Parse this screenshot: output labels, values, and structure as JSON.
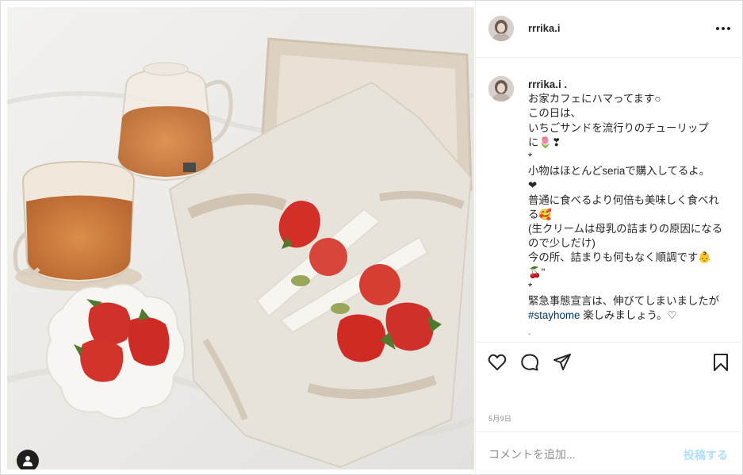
{
  "post": {
    "username": "rrrika.i",
    "caption_username": "rrrika.i .",
    "caption_lines": [
      "お家カフェにハマってます○",
      "この日は、",
      "いちごサンドを流行りのチューリップ",
      "に🌷❣",
      "*",
      "小物はほとんどseriaで購入してるよ。",
      "❤",
      "普通に食べるより何倍も美味しく食べれる🥰",
      "(生クリームは母乳の詰まりの原因になるので少しだけ)",
      "今の所、詰まりも何もなく順調です👶🍒\"",
      "*",
      "緊急事態宣言は、伸びてしまいましたが"
    ],
    "hashtag": "#stayhome",
    "caption_last_suffix": " 楽しみましょう。♡",
    "scroll_hint": "ˇ",
    "date": "5月9日"
  },
  "comment": {
    "placeholder": "コメントを追加...",
    "post_button": "投稿する"
  },
  "icons": {
    "more": "more-options-icon",
    "like": "heart-icon",
    "comment": "comment-icon",
    "share": "paper-plane-icon",
    "save": "bookmark-icon",
    "user_tag": "person-icon"
  },
  "colors": {
    "text": "#262626",
    "secondary": "#8e8e8e",
    "hashtag": "#00376b",
    "post_button_disabled": "#b2dffc",
    "border": "#efefef"
  }
}
